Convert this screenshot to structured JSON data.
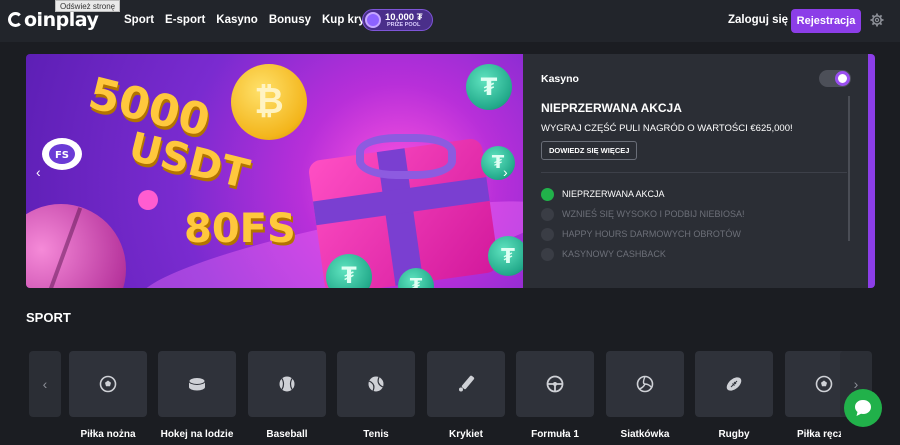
{
  "tooltip": "Odśwież stronę",
  "header": {
    "logo": "oinplay",
    "nav": [
      "Sport",
      "E-sport",
      "Kasyno",
      "Bonusy",
      "Kup krypto"
    ],
    "prize_amount": "10,000 ₮",
    "prize_label": "PRIZE POOL",
    "login": "Zaloguj się",
    "register": "Rejestracja"
  },
  "banner": {
    "line1": "5000",
    "line2": "USDT",
    "line3": "80FS",
    "coin_symbol": "₿",
    "tether_symbol": "₮"
  },
  "promo": {
    "category": "Kasyno",
    "title": "NIEPRZERWANA AKCJA",
    "description": "WYGRAJ CZĘŚĆ PULI NAGRÓD O WARTOŚCI €625,000!",
    "button": "DOWIEDZ SIĘ WIĘCEJ",
    "items": [
      {
        "label": "NIEPRZERWANA AKCJA",
        "active": true
      },
      {
        "label": "WZNIEŚ SIĘ WYSOKO I PODBIJ NIEBIOSA!",
        "active": false
      },
      {
        "label": "HAPPY HOURS DARMOWYCH OBROTÓW",
        "active": false
      },
      {
        "label": "KASYNOWY CASHBACK",
        "active": false
      }
    ]
  },
  "sport": {
    "title": "SPORT",
    "tiles": [
      {
        "label": "Piłka nożna",
        "icon": "soccer-ball-icon"
      },
      {
        "label": "Hokej na lodzie",
        "icon": "hockey-puck-icon"
      },
      {
        "label": "Baseball",
        "icon": "baseball-icon"
      },
      {
        "label": "Tenis",
        "icon": "tennis-ball-icon"
      },
      {
        "label": "Krykiet",
        "icon": "cricket-bat-icon"
      },
      {
        "label": "Formuła 1",
        "icon": "steering-wheel-icon"
      },
      {
        "label": "Siatkówka",
        "icon": "volleyball-icon"
      },
      {
        "label": "Rugby",
        "icon": "rugby-ball-icon"
      },
      {
        "label": "Piłka ręczna",
        "icon": "handball-icon"
      }
    ]
  },
  "colors": {
    "accent": "#8c3ee8",
    "active": "#21b14a",
    "background": "#1b1d22"
  }
}
